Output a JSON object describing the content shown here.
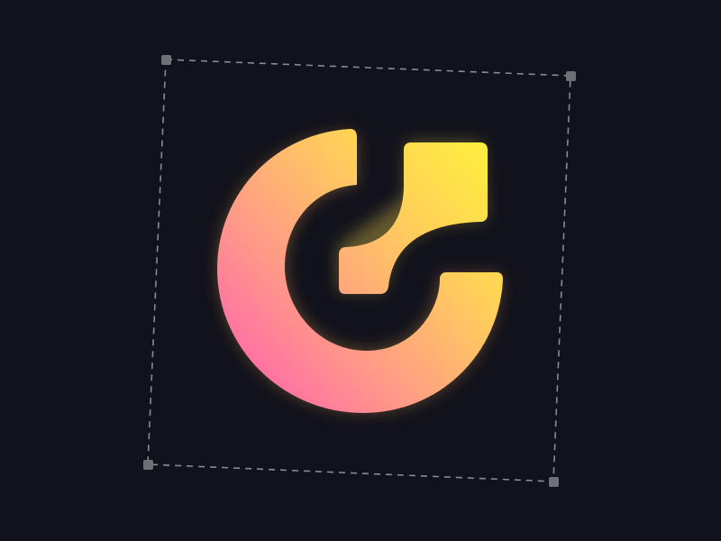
{
  "canvas": {
    "background": "#12121c"
  },
  "logo": {
    "icon": "gradient-g-mark-icon",
    "gradient": [
      "#ff5fb0",
      "#ff9c86",
      "#ffd257",
      "#fff23a"
    ],
    "glow_color": "#ffb14d"
  },
  "selection_box": {
    "icon": "transform-selection-frame",
    "stroke_color": "#8a8a92",
    "handle_color": "#6f6f78"
  }
}
